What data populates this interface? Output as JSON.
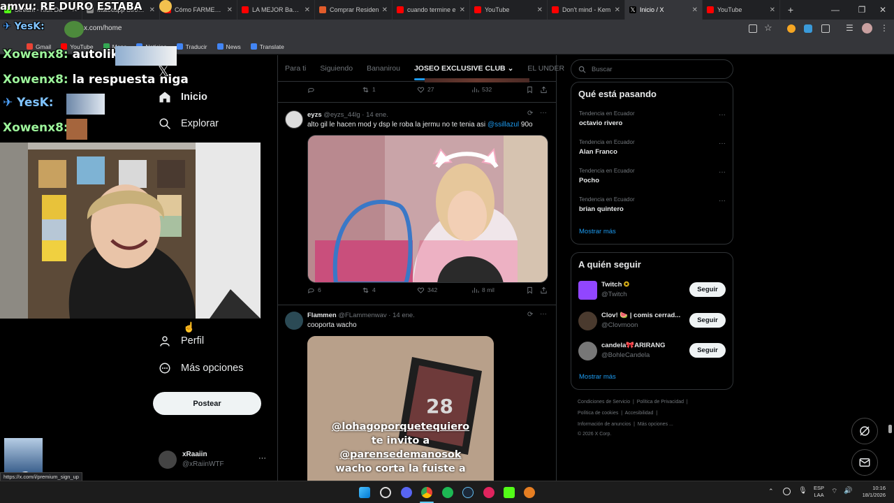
{
  "browser": {
    "tabs": [
      {
        "label": "Stream - Kick Da",
        "fav": "kick"
      },
      {
        "label": "Matecapp Stream",
        "fav": "generic"
      },
      {
        "label": "Cómo FARMEAR C",
        "fav": "youtube"
      },
      {
        "label": "LA MEJOR Base C",
        "fav": "youtube"
      },
      {
        "label": "Comprar Residen",
        "fav": "generic"
      },
      {
        "label": "cuando termine e",
        "fav": "youtube"
      },
      {
        "label": "YouTube",
        "fav": "youtube"
      },
      {
        "label": "Don't mind - Kem",
        "fav": "youtube"
      },
      {
        "label": "Inicio / X",
        "fav": "x",
        "active": true
      },
      {
        "label": "YouTube",
        "fav": "youtube"
      }
    ],
    "url": "x.com/home",
    "bookmarks": [
      "Gmail",
      "YouTube",
      "Maps",
      "Noticias",
      "Traducir",
      "News",
      "Translate"
    ],
    "status_url": "https://x.com/i/premium_sign_up"
  },
  "stream_overlay": {
    "title": "amvu: RE DURO ESTABA",
    "chat": [
      {
        "user": "Xowenx8:",
        "msg": "autolike"
      },
      {
        "user": "Xowenx8:",
        "msg": "la respuesta niga"
      },
      {
        "user": "YesK:",
        "msg": ""
      },
      {
        "user": "Xowenx8:",
        "msg": ""
      }
    ]
  },
  "nav": {
    "home": "Inicio",
    "explore": "Explorar",
    "profile": "Perfil",
    "more": "Más opciones",
    "post": "Postear",
    "account_name": "xRaaiin",
    "account_handle": "@xRaiinWTF"
  },
  "feed": {
    "tabs": [
      "Para ti",
      "Siguiendo",
      "Bananirou",
      "JOSEO EXCLUSIVE CLUB",
      "EL UNDER"
    ],
    "active_tab": 3,
    "top_actions": {
      "replies": "",
      "reposts": "1",
      "likes": "27",
      "views": "532"
    },
    "tweets": [
      {
        "name": "eyzs",
        "handle": "@eyzs_44lg",
        "date": "14 ene.",
        "text": "alto gil le hacen mod y dsp le roba la jermu no te tenia asi ",
        "mention": "@ssillazul",
        "suffix": " 90o",
        "replies": "6",
        "reposts": "4",
        "likes": "342",
        "views": "8 mil"
      },
      {
        "name": "Flammen",
        "handle": "@FLammenwav",
        "date": "14 ene.",
        "text": "cooporta wacho",
        "overlay_lines": [
          "@lohagoporquetequiero",
          "te invito a",
          "@parensedemanosok",
          "wacho corta la fuiste a"
        ]
      }
    ]
  },
  "sidebar": {
    "search_placeholder": "Buscar",
    "trends_title": "Qué está pasando",
    "trends": [
      {
        "caption": "Tendencia en Ecuador",
        "name": "octavio rivero"
      },
      {
        "caption": "Tendencia en Ecuador",
        "name": "Alan Franco"
      },
      {
        "caption": "Tendencia en Ecuador",
        "name": "Pocho"
      },
      {
        "caption": "Tendencia en Ecuador",
        "name": "brian quintero"
      }
    ],
    "show_more": "Mostrar más",
    "who_title": "A quién seguir",
    "who": [
      {
        "name": "Twitch",
        "handle": "@Twitch",
        "button": "Seguir"
      },
      {
        "name": "Clov! 🍉 | comis cerrad...",
        "handle": "@Clovmoon",
        "button": "Seguir"
      },
      {
        "name": "candela🎀ARIRANG",
        "handle": "@BohleCandela",
        "button": "Seguir"
      }
    ],
    "footer": [
      "Condiciones de Servicio",
      "Política de Privacidad",
      "Política de cookies",
      "Accesibilidad",
      "Información de anuncios",
      "Más opciones ...",
      "© 2026 X Corp."
    ]
  },
  "taskbar": {
    "lang1": "ESP",
    "lang2": "LAA",
    "time": "10:16",
    "date": "18/1/2026"
  },
  "colors": {
    "accent": "#1d9bf0",
    "background": "#000000",
    "border": "#2f3336",
    "muted": "#71767b"
  }
}
